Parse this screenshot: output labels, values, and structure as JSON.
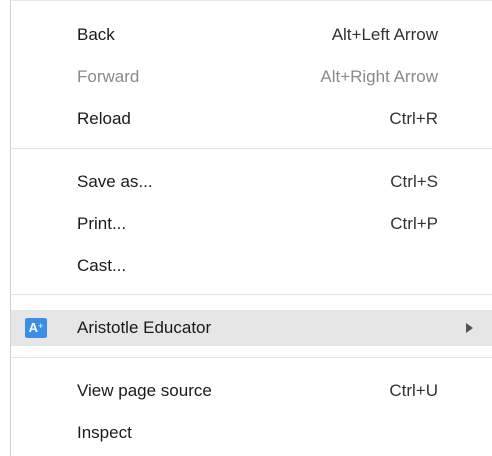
{
  "menu": {
    "items": [
      {
        "label": "Back",
        "shortcut": "Alt+Left Arrow",
        "enabled": true
      },
      {
        "label": "Forward",
        "shortcut": "Alt+Right Arrow",
        "enabled": false
      },
      {
        "label": "Reload",
        "shortcut": "Ctrl+R",
        "enabled": true
      },
      {
        "label": "Save as...",
        "shortcut": "Ctrl+S",
        "enabled": true
      },
      {
        "label": "Print...",
        "shortcut": "Ctrl+P",
        "enabled": true
      },
      {
        "label": "Cast...",
        "shortcut": "",
        "enabled": true
      },
      {
        "label": "Aristotle Educator",
        "shortcut": "",
        "enabled": true,
        "icon": "aristotle-educator-icon",
        "icon_text": "A",
        "icon_sup": "+",
        "icon_color": "#3a8ee6",
        "submenu": true,
        "highlighted": true
      },
      {
        "label": "View page source",
        "shortcut": "Ctrl+U",
        "enabled": true
      },
      {
        "label": "Inspect",
        "shortcut": "",
        "enabled": true
      }
    ]
  }
}
